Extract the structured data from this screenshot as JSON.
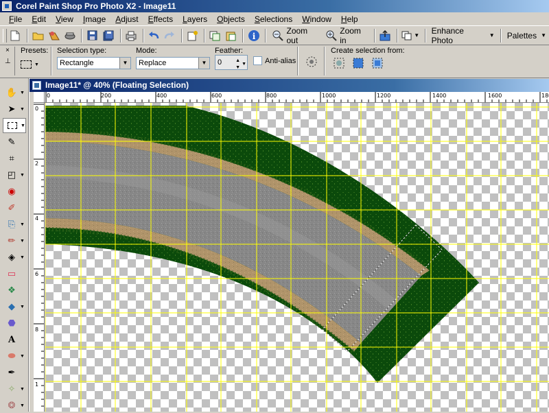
{
  "app": {
    "title": "Corel Paint Shop Pro Photo X2 - Image11"
  },
  "menubar": {
    "items": [
      "File",
      "Edit",
      "View",
      "Image",
      "Adjust",
      "Effects",
      "Layers",
      "Objects",
      "Selections",
      "Window",
      "Help"
    ]
  },
  "toolbar": {
    "zoom_out_label": "Zoom out",
    "zoom_in_label": "Zoom in",
    "enhance_photo_label": "Enhance Photo",
    "palettes_label": "Palettes"
  },
  "options": {
    "presets_label": "Presets:",
    "selection_type_label": "Selection type:",
    "selection_type_value": "Rectangle",
    "mode_label": "Mode:",
    "mode_value": "Replace",
    "feather_label": "Feather:",
    "feather_value": "0",
    "antialias_label": "Anti-alias",
    "antialias_checked": false,
    "create_selection_label": "Create selection from:"
  },
  "document": {
    "title": "Image11*  @  40% (Floating Selection)",
    "hruler_labels": [
      "0",
      "200",
      "400",
      "600",
      "800",
      "1000",
      "1200",
      "1400",
      "1600",
      "180"
    ],
    "vruler_labels": [
      "0",
      "2",
      "4",
      "6",
      "8",
      "1"
    ]
  },
  "colors": {
    "title_bar": "#0a246a",
    "grid_line": "#ffff00",
    "grass": "#0b4a0b",
    "dirt": "#b0946a",
    "asphalt": "#8a8a8a"
  }
}
